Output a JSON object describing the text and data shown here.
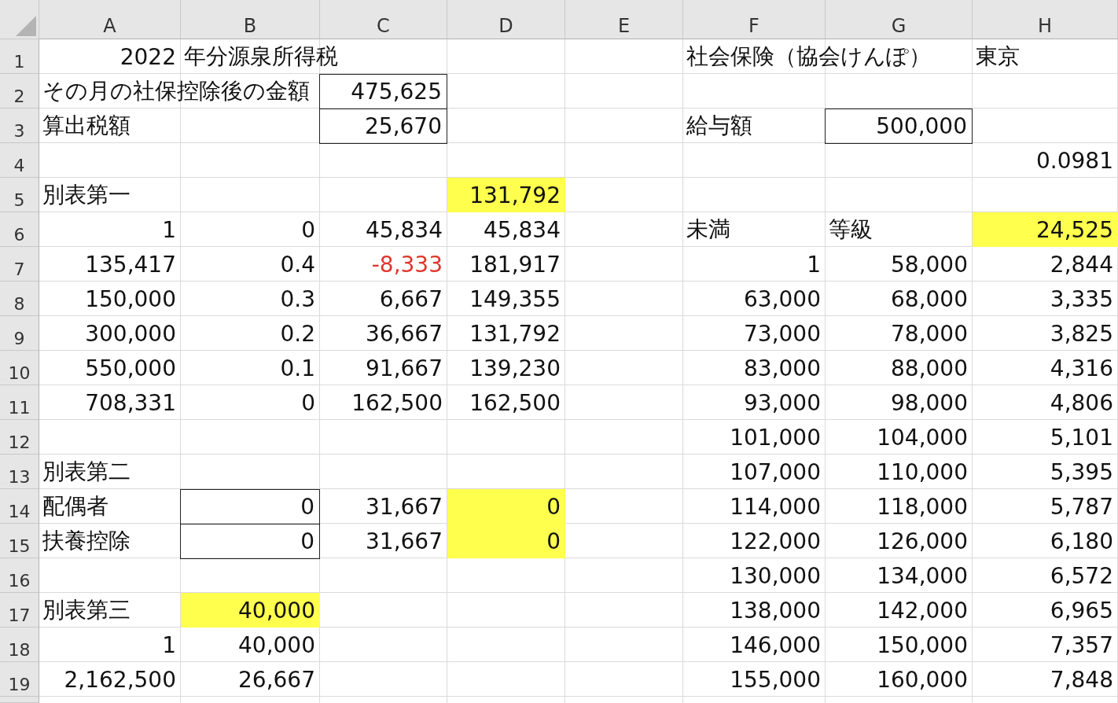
{
  "columns": [
    "A",
    "B",
    "C",
    "D",
    "E",
    "F",
    "G",
    "H"
  ],
  "rows": [
    {
      "number": "1",
      "cells": [
        {
          "kind": "number",
          "text": "2022"
        },
        {
          "kind": "text",
          "text": "年分源泉所得税"
        },
        {},
        {},
        {},
        {
          "kind": "text",
          "text": "社会保険（協会けんぽ）"
        },
        {},
        {
          "kind": "text",
          "text": "東京"
        }
      ]
    },
    {
      "number": "2",
      "cells": [
        {
          "kind": "text",
          "text": "その月の社保控除後の金額"
        },
        {},
        {
          "kind": "boxed-number",
          "text": "475,625"
        },
        {},
        {},
        {},
        {},
        {}
      ]
    },
    {
      "number": "3",
      "cells": [
        {
          "kind": "text",
          "text": "算出税額"
        },
        {},
        {
          "kind": "boxed-number",
          "text": "25,670"
        },
        {},
        {},
        {
          "kind": "text",
          "text": "給与額"
        },
        {
          "kind": "boxed-number",
          "text": "500,000"
        },
        {}
      ]
    },
    {
      "number": "4",
      "cells": [
        {},
        {},
        {},
        {},
        {},
        {},
        {},
        {
          "kind": "number",
          "text": "0.0981"
        }
      ]
    },
    {
      "number": "5",
      "cells": [
        {
          "kind": "text",
          "text": "別表第一"
        },
        {},
        {},
        {
          "kind": "highlighted-number",
          "text": "131,792"
        },
        {},
        {},
        {},
        {}
      ]
    },
    {
      "number": "6",
      "cells": [
        {
          "kind": "number",
          "text": "1"
        },
        {
          "kind": "number",
          "text": "0"
        },
        {
          "kind": "number",
          "text": "45,834"
        },
        {
          "kind": "number",
          "text": "45,834"
        },
        {},
        {
          "kind": "text",
          "text": "未満"
        },
        {
          "kind": "text",
          "text": "等級"
        },
        {
          "kind": "highlighted-number",
          "text": "24,525"
        }
      ]
    },
    {
      "number": "7",
      "cells": [
        {
          "kind": "number",
          "text": "135,417"
        },
        {
          "kind": "number",
          "text": "0.4"
        },
        {
          "kind": "negative-number",
          "text": "-8,333"
        },
        {
          "kind": "number",
          "text": "181,917"
        },
        {},
        {
          "kind": "number",
          "text": "1"
        },
        {
          "kind": "number",
          "text": "58,000"
        },
        {
          "kind": "number",
          "text": "2,844"
        }
      ]
    },
    {
      "number": "8",
      "cells": [
        {
          "kind": "number",
          "text": "150,000"
        },
        {
          "kind": "number",
          "text": "0.3"
        },
        {
          "kind": "number",
          "text": "6,667"
        },
        {
          "kind": "number",
          "text": "149,355"
        },
        {},
        {
          "kind": "number",
          "text": "63,000"
        },
        {
          "kind": "number",
          "text": "68,000"
        },
        {
          "kind": "number",
          "text": "3,335"
        }
      ]
    },
    {
      "number": "9",
      "cells": [
        {
          "kind": "number",
          "text": "300,000"
        },
        {
          "kind": "number",
          "text": "0.2"
        },
        {
          "kind": "number",
          "text": "36,667"
        },
        {
          "kind": "number",
          "text": "131,792"
        },
        {},
        {
          "kind": "number",
          "text": "73,000"
        },
        {
          "kind": "number",
          "text": "78,000"
        },
        {
          "kind": "number",
          "text": "3,825"
        }
      ]
    },
    {
      "number": "10",
      "cells": [
        {
          "kind": "number",
          "text": "550,000"
        },
        {
          "kind": "number",
          "text": "0.1"
        },
        {
          "kind": "number",
          "text": "91,667"
        },
        {
          "kind": "number",
          "text": "139,230"
        },
        {},
        {
          "kind": "number",
          "text": "83,000"
        },
        {
          "kind": "number",
          "text": "88,000"
        },
        {
          "kind": "number",
          "text": "4,316"
        }
      ]
    },
    {
      "number": "11",
      "cells": [
        {
          "kind": "number",
          "text": "708,331"
        },
        {
          "kind": "number",
          "text": "0"
        },
        {
          "kind": "number",
          "text": "162,500"
        },
        {
          "kind": "number",
          "text": "162,500"
        },
        {},
        {
          "kind": "number",
          "text": "93,000"
        },
        {
          "kind": "number",
          "text": "98,000"
        },
        {
          "kind": "number",
          "text": "4,806"
        }
      ]
    },
    {
      "number": "12",
      "cells": [
        {},
        {},
        {},
        {},
        {},
        {
          "kind": "number",
          "text": "101,000"
        },
        {
          "kind": "number",
          "text": "104,000"
        },
        {
          "kind": "number",
          "text": "5,101"
        }
      ]
    },
    {
      "number": "13",
      "cells": [
        {
          "kind": "text",
          "text": "別表第二"
        },
        {},
        {},
        {},
        {},
        {
          "kind": "number",
          "text": "107,000"
        },
        {
          "kind": "number",
          "text": "110,000"
        },
        {
          "kind": "number",
          "text": "5,395"
        }
      ]
    },
    {
      "number": "14",
      "cells": [
        {
          "kind": "text",
          "text": "配偶者"
        },
        {
          "kind": "boxed-number",
          "text": "0"
        },
        {
          "kind": "number",
          "text": "31,667"
        },
        {
          "kind": "highlighted-number",
          "text": "0"
        },
        {},
        {
          "kind": "number",
          "text": "114,000"
        },
        {
          "kind": "number",
          "text": "118,000"
        },
        {
          "kind": "number",
          "text": "5,787"
        }
      ]
    },
    {
      "number": "15",
      "cells": [
        {
          "kind": "text",
          "text": "扶養控除"
        },
        {
          "kind": "boxed-number",
          "text": "0"
        },
        {
          "kind": "number",
          "text": "31,667"
        },
        {
          "kind": "highlighted-number",
          "text": "0"
        },
        {},
        {
          "kind": "number",
          "text": "122,000"
        },
        {
          "kind": "number",
          "text": "126,000"
        },
        {
          "kind": "number",
          "text": "6,180"
        }
      ]
    },
    {
      "number": "16",
      "cells": [
        {},
        {},
        {},
        {},
        {},
        {
          "kind": "number",
          "text": "130,000"
        },
        {
          "kind": "number",
          "text": "134,000"
        },
        {
          "kind": "number",
          "text": "6,572"
        }
      ]
    },
    {
      "number": "17",
      "cells": [
        {
          "kind": "text",
          "text": "別表第三"
        },
        {
          "kind": "highlighted-number",
          "text": "40,000"
        },
        {},
        {},
        {},
        {
          "kind": "number",
          "text": "138,000"
        },
        {
          "kind": "number",
          "text": "142,000"
        },
        {
          "kind": "number",
          "text": "6,965"
        }
      ]
    },
    {
      "number": "18",
      "cells": [
        {
          "kind": "number",
          "text": "1"
        },
        {
          "kind": "number",
          "text": "40,000"
        },
        {},
        {},
        {},
        {
          "kind": "number",
          "text": "146,000"
        },
        {
          "kind": "number",
          "text": "150,000"
        },
        {
          "kind": "number",
          "text": "7,357"
        }
      ]
    },
    {
      "number": "19",
      "cells": [
        {
          "kind": "number",
          "text": "2,162,500"
        },
        {
          "kind": "number",
          "text": "26,667"
        },
        {},
        {},
        {},
        {
          "kind": "number",
          "text": "155,000"
        },
        {
          "kind": "number",
          "text": "160,000"
        },
        {
          "kind": "number",
          "text": "7,848"
        }
      ]
    }
  ]
}
